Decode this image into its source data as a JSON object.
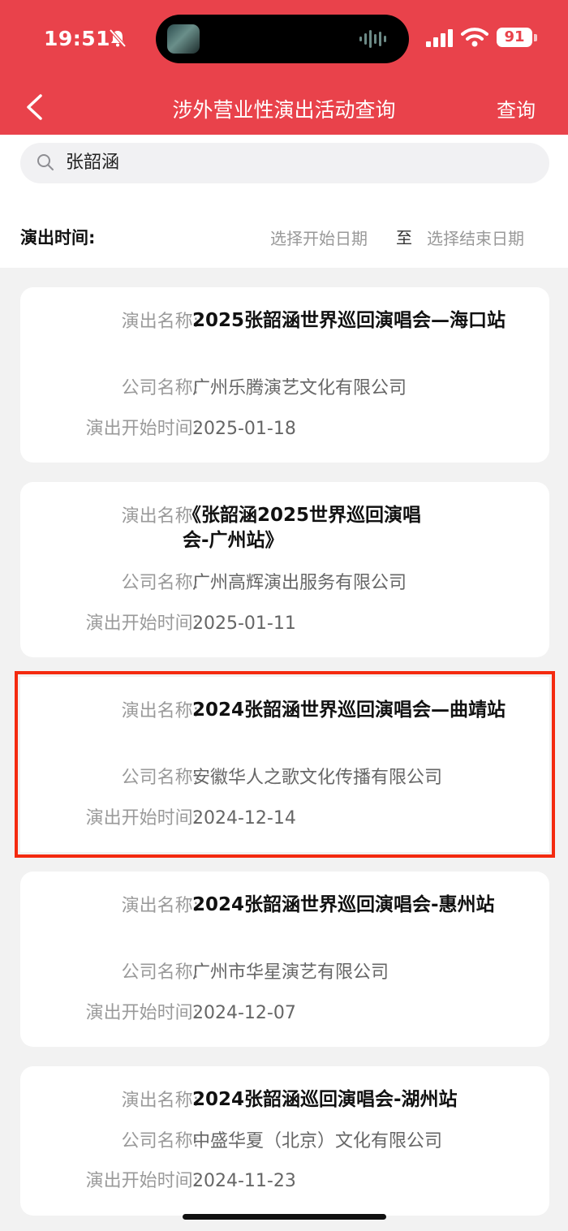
{
  "status_bar": {
    "time": "19:51",
    "battery": "91"
  },
  "header": {
    "title": "涉外营业性演出活动查询",
    "query_label": "查询"
  },
  "search": {
    "value": "张韶涵"
  },
  "date_filter": {
    "label": "演出时间:",
    "start_placeholder": "选择开始日期",
    "separator": "至",
    "end_placeholder": "选择结束日期"
  },
  "labels": {
    "name": "演出名称:",
    "company": "公司名称:",
    "start_time": "演出开始时间:"
  },
  "results": [
    {
      "name": "2025张韶涵世界巡回演唱会—海口站",
      "company": "广州乐腾演艺文化有限公司",
      "date": "2025-01-18"
    },
    {
      "name": "《张韶涵2025世界巡回演唱会-广州站》",
      "company": "广州高辉演出服务有限公司",
      "date": "2025-01-11"
    },
    {
      "name": "2024张韶涵世界巡回演唱会—曲靖站",
      "company": "安徽华人之歌文化传播有限公司",
      "date": "2024-12-14",
      "highlighted": true
    },
    {
      "name": "2024张韶涵世界巡回演唱会-惠州站",
      "company": "广州市华星演艺有限公司",
      "date": "2024-12-07"
    },
    {
      "name": "2024张韶涵巡回演唱会-湖州站",
      "company": "中盛华夏（北京）文化有限公司",
      "date": "2024-11-23"
    }
  ],
  "colors": {
    "header": "#e9424b",
    "highlight_border": "#f42a0f"
  }
}
